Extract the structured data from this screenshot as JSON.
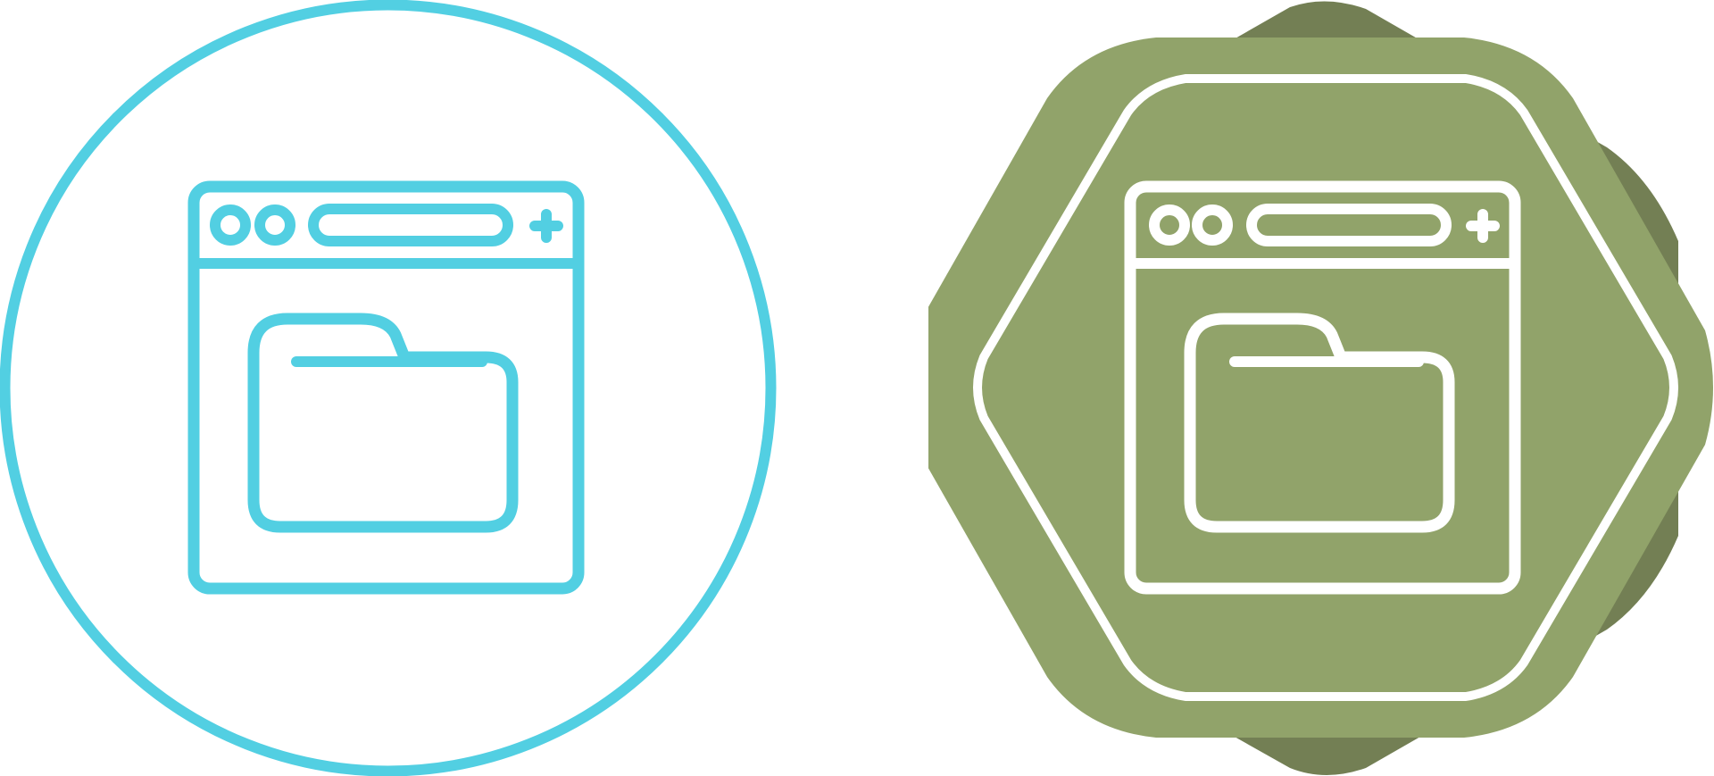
{
  "icons": [
    {
      "name": "folder-browser-window-icon",
      "style": "outline-in-circle",
      "colors": {
        "stroke": "#52cfe2",
        "background": "#ffffff"
      }
    },
    {
      "name": "folder-browser-window-icon",
      "style": "white-outline-on-badge",
      "colors": {
        "stroke": "#ffffff",
        "badge_front": "#91a36a",
        "badge_back": "#737f54"
      }
    }
  ]
}
